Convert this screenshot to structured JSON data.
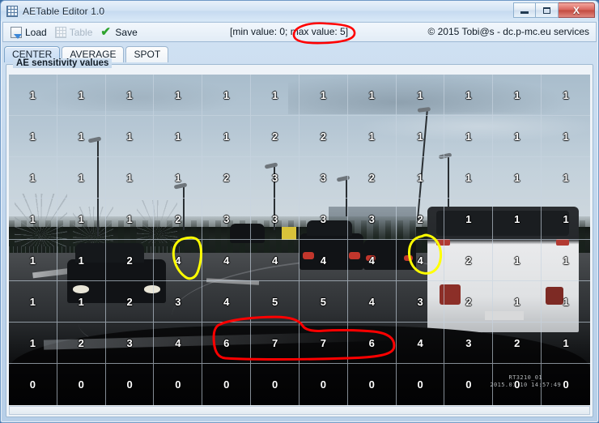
{
  "window": {
    "title": "AETable Editor 1.0",
    "icon": "table-grid-icon",
    "minimize_label": "",
    "maximize_label": "",
    "close_label": "X"
  },
  "toolbar": {
    "load_label": "Load",
    "table_label": "Table",
    "save_label": "Save",
    "range_text": "[min value: 0; max value: 5]",
    "copyright": "© 2015 Tobi@s - dc.p-mc.eu services"
  },
  "tabs": [
    {
      "label": "CENTER",
      "active": true
    },
    {
      "label": "AVERAGE",
      "active": false
    },
    {
      "label": "SPOT",
      "active": false
    }
  ],
  "panel": {
    "title": "AE sensitivity values"
  },
  "photo": {
    "stamp_id": "RT3210_01",
    "stamp_datetime": "2015.01.10  14:57:49"
  },
  "annotations": {
    "red_color": "#ff0000",
    "yellow_color": "#ffff00"
  },
  "chart_data": {
    "type": "heatmap",
    "title": "AE sensitivity values",
    "rows": 8,
    "columns": 12,
    "min_value": 0,
    "max_value": 5,
    "values": [
      [
        1,
        1,
        1,
        1,
        1,
        1,
        1,
        1,
        1,
        1,
        1,
        1
      ],
      [
        1,
        1,
        1,
        1,
        1,
        2,
        2,
        1,
        1,
        1,
        1,
        1
      ],
      [
        1,
        1,
        1,
        1,
        2,
        3,
        3,
        2,
        1,
        1,
        1,
        1
      ],
      [
        1,
        1,
        1,
        2,
        3,
        3,
        3,
        3,
        2,
        1,
        1,
        1
      ],
      [
        1,
        1,
        2,
        4,
        4,
        4,
        4,
        4,
        4,
        2,
        1,
        1
      ],
      [
        1,
        1,
        2,
        3,
        4,
        5,
        5,
        4,
        3,
        2,
        1,
        1
      ],
      [
        1,
        2,
        3,
        4,
        6,
        7,
        7,
        6,
        4,
        3,
        2,
        1
      ],
      [
        0,
        0,
        0,
        0,
        0,
        0,
        0,
        0,
        0,
        0,
        0,
        0
      ]
    ],
    "highlighted_cells_yellow": [
      {
        "row": 4,
        "col": 3,
        "value": 4
      },
      {
        "row": 4,
        "col": 8,
        "value": 4
      }
    ],
    "highlighted_cells_red": [
      {
        "row": 6,
        "col": 4,
        "value": 6
      },
      {
        "row": 6,
        "col": 5,
        "value": 7
      },
      {
        "row": 6,
        "col": 6,
        "value": 7
      },
      {
        "row": 6,
        "col": 7,
        "value": 6
      }
    ]
  }
}
